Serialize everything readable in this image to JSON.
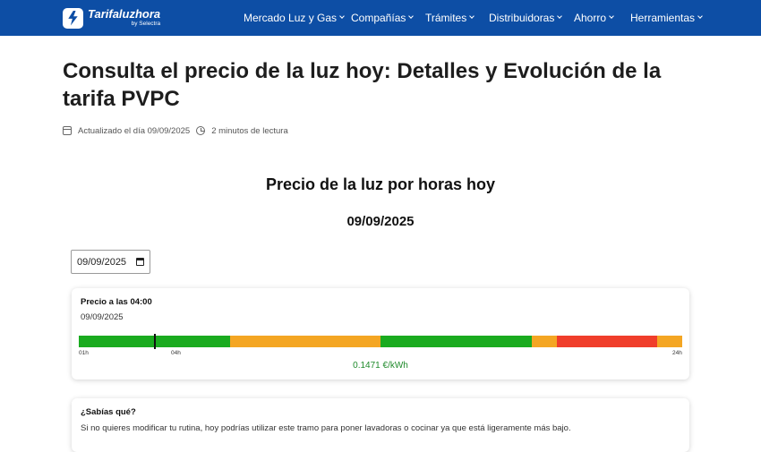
{
  "header": {
    "logo_name": "Tarifaluzhora",
    "logo_sub": "by Selectra",
    "nav": [
      {
        "label": "Mercado Luz y Gas"
      },
      {
        "label": "Compañías"
      },
      {
        "label": "Trámites"
      },
      {
        "label": "Distribuidoras"
      },
      {
        "label": "Ahorro"
      },
      {
        "label": "Herramientas"
      }
    ]
  },
  "article": {
    "title": "Consulta el precio de la luz hoy: Detalles y Evolución de la tarifa PVPC",
    "updated": "Actualizado el día 09/09/2025",
    "read_time": "2 minutos de lectura"
  },
  "prices": {
    "heading": "Precio de la luz por horas hoy",
    "date_heading": "09/09/2025",
    "date_input_value": "09/09/2025"
  },
  "price_card": {
    "title": "Precio a las 04:00",
    "date": "09/09/2025",
    "price": "0.1471 €/kWh",
    "ticks": [
      "01h",
      "04h",
      "24h"
    ],
    "current_hour": 4,
    "segments": [
      {
        "start": 0,
        "end": 6,
        "level": "low"
      },
      {
        "start": 6,
        "end": 12,
        "level": "medium"
      },
      {
        "start": 12,
        "end": 18,
        "level": "low"
      },
      {
        "start": 18,
        "end": 19,
        "level": "medium"
      },
      {
        "start": 19,
        "end": 23,
        "level": "high"
      },
      {
        "start": 23,
        "end": 24,
        "level": "medium"
      }
    ],
    "colors": {
      "low": "#1aab1f",
      "medium": "#f4a623",
      "high": "#f03e2b"
    }
  },
  "tip_card": {
    "title": "¿Sabías qué?",
    "text": "Si no quieres modificar tu rutina, hoy podrías utilizar este tramo para poner lavadoras o cocinar ya que está ligeramente más bajo."
  }
}
